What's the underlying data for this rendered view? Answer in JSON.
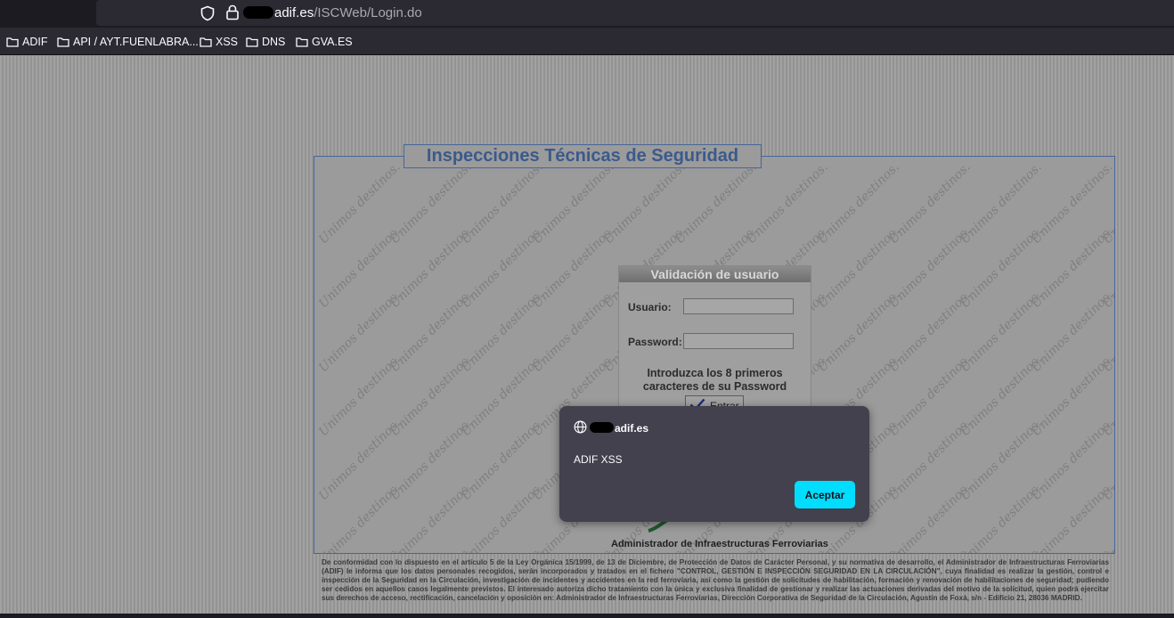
{
  "browser": {
    "url_domain": "adif.es",
    "url_path": "/ISCWeb/Login.do",
    "bookmarks": [
      "ADIF",
      "API / AYT.FUENLABRA...",
      "XSS",
      "DNS",
      "GVA.ES"
    ]
  },
  "page": {
    "title": "Inspecciones Técnicas de Seguridad",
    "watermark": "Unimos destinos.",
    "login": {
      "header": "Validación de usuario",
      "user_label": "Usuario:",
      "password_label": "Password:",
      "hint": "Introduzca los 8 primeros caracteres de su Password",
      "submit_label": "Entrar"
    },
    "company": "Administrador de Infraestructuras Ferroviarias",
    "legal": "De conformidad con lo dispuesto en el artículo 5 de la Ley Orgánica 15/1999, de 13 de Diciembre, de Protección de Datos de Carácter Personal, y su normativa de desarrollo, el Administrador de Infraestructuras Ferroviarias (ADIF) le informa que los datos personales recogidos, serán incorporados y tratados en el fichero \"CONTROL, GESTIÓN E INSPECCIÓN SEGURIDAD EN LA CIRCULACIÓN\", cuya finalidad es realizar la gestión, control e inspección de la Seguridad en la Circulación, investigación de incidentes y accidentes en la red ferroviaria, así como la gestión de solicitudes de habilitación, formación y renovación de habilitaciones de seguridad; pudiendo ser cedidos en aquellos casos legalmente previstos. El interesado autoriza dicho tratamiento con la única y exclusiva finalidad de gestionar y realizar las actuaciones derivadas del motivo de la solicitud, quien podrá ejercitar sus derechos de acceso, rectificación, cancelación y oposición en: Administrador de Infraestructuras Ferroviarias, Dirección Corporativa de Seguridad de la Circulación, Agustín de Foxá, s/n - Edificio 21, 28036 MADRID."
  },
  "dialog": {
    "origin": "adif.es",
    "message": "ADIF XSS",
    "button": "Aceptar"
  },
  "colors": {
    "accent_button": "#00ddff",
    "dialog_bg": "#42414d",
    "title_text": "#3b5a8c"
  }
}
